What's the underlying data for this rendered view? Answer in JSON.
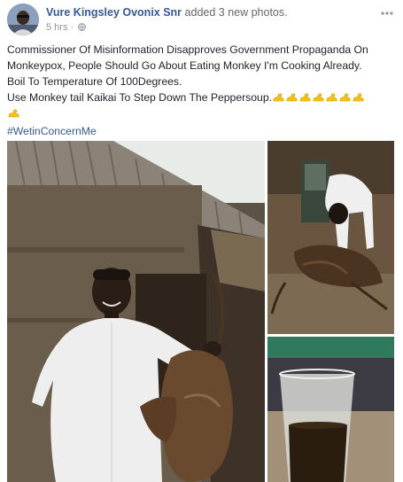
{
  "post": {
    "author_name": "Vure Kingsley Ovonix Snr",
    "action_text": "added 3 new photos.",
    "timestamp": "5 hrs",
    "privacy_icon": "globe-icon",
    "menu_icon": "ellipsis-icon",
    "text_lines": [
      "Commissioner Of Misinformation Disapproves Government Propaganda On",
      "Monkeypox, People Should Go About Eating Monkey I'm Cooking Already.",
      "Boil To Temperature Of 100Degrees.",
      "Use Monkey tail Kaikai To Step Down The Peppersoup."
    ],
    "emoji_name": "flexed-biceps-emoji",
    "hashtag": "#WetinConcernMe"
  },
  "colors": {
    "link": "#365899",
    "text": "#1d2129",
    "meta": "#90949c",
    "emoji": "#f4c21b"
  }
}
